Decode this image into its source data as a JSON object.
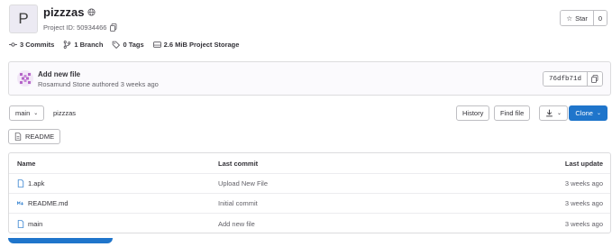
{
  "project": {
    "avatar_letter": "P",
    "name": "pizzzas",
    "id_text": "Project ID: 50934466"
  },
  "star": {
    "label": "Star",
    "count": "0"
  },
  "stats": {
    "commits": "3 Commits",
    "branches": "1 Branch",
    "tags": "0 Tags",
    "storage": "2.6 MiB Project Storage"
  },
  "commit": {
    "title": "Add new file",
    "meta": "Rosamund Stone authored 3 weeks ago",
    "sha": "76dfb71d"
  },
  "toolbar": {
    "branch": "main",
    "breadcrumb": "pizzzas",
    "history": "History",
    "find_file": "Find file",
    "clone": "Clone"
  },
  "readme_button": "README",
  "table": {
    "headers": {
      "name": "Name",
      "last_commit": "Last commit",
      "last_update": "Last update"
    },
    "rows": [
      {
        "name": "1.apk",
        "commit": "Upload New File",
        "date": "3 weeks ago",
        "icon": "file-icon"
      },
      {
        "name": "README.md",
        "commit": "Initial commit",
        "date": "3 weeks ago",
        "icon": "markdown-icon"
      },
      {
        "name": "main",
        "commit": "Add new file",
        "date": "3 weeks ago",
        "icon": "file-icon"
      }
    ]
  },
  "colors": {
    "primary": "#1f75cb",
    "border": "#dcdcde",
    "muted": "#626168"
  }
}
